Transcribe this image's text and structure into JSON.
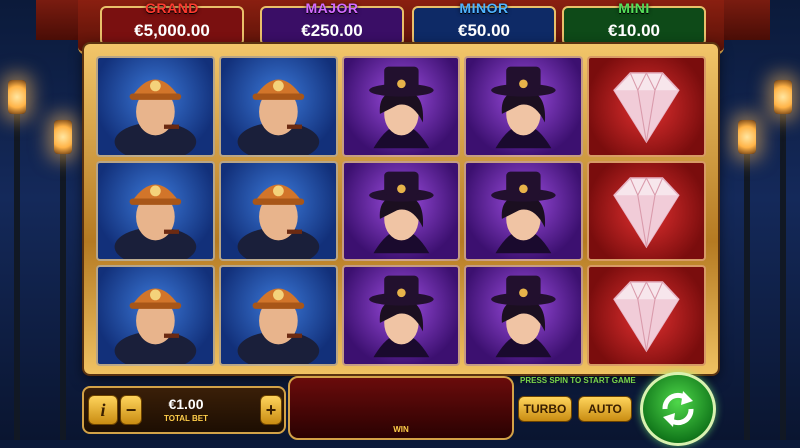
{
  "jackpots": [
    {
      "name": "GRAND",
      "value": "€5,000.00",
      "name_color": "#ff3b2f",
      "bg": "#7a1010"
    },
    {
      "name": "MAJOR",
      "value": "€250.00",
      "name_color": "#d46bff",
      "bg": "#3a0e66"
    },
    {
      "name": "MINOR",
      "value": "€50.00",
      "name_color": "#4fb4ff",
      "bg": "#0e2a66"
    },
    {
      "name": "MINI",
      "value": "€10.00",
      "name_color": "#55e05a",
      "bg": "#0e4a18"
    }
  ],
  "reels": [
    [
      "detective",
      "detective",
      "detective"
    ],
    [
      "detective",
      "detective",
      "detective"
    ],
    [
      "lady",
      "lady",
      "lady"
    ],
    [
      "lady",
      "lady",
      "lady"
    ],
    [
      "diamond",
      "diamond",
      "diamond"
    ]
  ],
  "controls": {
    "info_label": "i",
    "minus_label": "−",
    "plus_label": "+",
    "bet_value": "€1.00",
    "bet_label": "TOTAL BET",
    "win_label": "WIN",
    "press_spin_msg": "PRESS SPIN TO START GAME",
    "turbo_label": "TURBO",
    "auto_label": "AUTO"
  },
  "colors": {
    "accent_gold": "#d3a247",
    "spin_green": "#2fb83a"
  }
}
